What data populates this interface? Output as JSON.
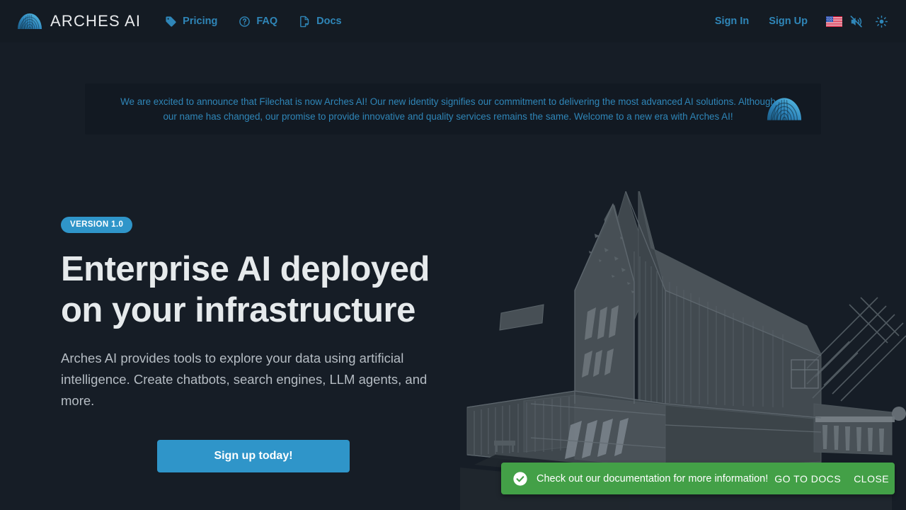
{
  "header": {
    "brand_name": "ARCHES AI",
    "brand_logo_icon": "arch-dome-logo",
    "nav": [
      {
        "label": "Pricing",
        "icon": "price-tag-icon"
      },
      {
        "label": "FAQ",
        "icon": "question-circle-icon"
      },
      {
        "label": "Docs",
        "icon": "document-cursor-icon"
      }
    ],
    "sign_in_label": "Sign In",
    "sign_up_label": "Sign Up",
    "language_icon": "us-flag-icon",
    "sound_icon": "speaker-muted-icon",
    "theme_icon": "sun-icon"
  },
  "banner": {
    "line1": "We are excited to announce that Filechat is now Arches AI! Our new identity signifies our commitment to delivering the most advanced AI solutions.",
    "line2": "Although our name has changed, our promise to provide innovative and quality services remains the same. Welcome to a new era with Arches AI!",
    "logo_icon": "arch-dome-logo"
  },
  "hero": {
    "version_badge": "VERSION 1.0",
    "title_line1": "Enterprise AI deployed",
    "title_line2": "on your infrastructure",
    "subtitle": "Arches AI provides tools to explore your data using artificial intelligence. Create chatbots, search engines, LLM agents, and more.",
    "cta_label": "Sign up today!",
    "illustration_icon": "architecture-building-sketch"
  },
  "toast": {
    "icon": "check-circle-icon",
    "message": "Check out our documentation for more information!",
    "action_primary": "GO TO DOCS",
    "action_secondary": "CLOSE"
  },
  "colors": {
    "page_background": "#161d26",
    "header_background": "#141b23",
    "banner_background": "#121922",
    "accent_blue": "#2f86b8",
    "button_blue": "#2f95c9",
    "toast_green": "#43a047",
    "title_text": "#e6eaec",
    "body_text": "#b5bcc3"
  }
}
